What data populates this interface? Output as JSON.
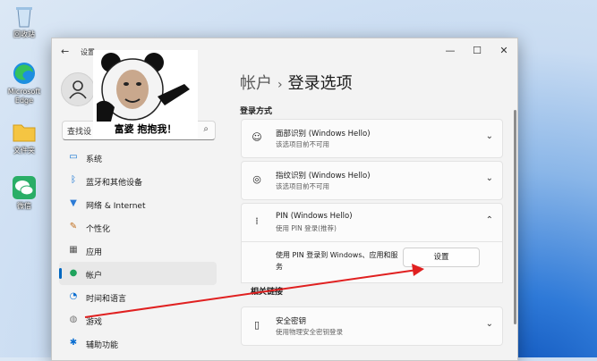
{
  "desktop": {
    "icons": [
      {
        "label": "回收站",
        "icon": "recycle-bin-icon"
      },
      {
        "label": "Microsoft Edge",
        "icon": "edge-icon"
      },
      {
        "label": "文件夹",
        "icon": "folder-icon"
      },
      {
        "label": "微信",
        "icon": "wechat-icon"
      }
    ]
  },
  "window": {
    "title": "设置",
    "controls": {
      "minimize": "—",
      "maximize": "☐",
      "close": "✕"
    }
  },
  "sidebar": {
    "search_value": "查找设",
    "items": [
      {
        "label": "系统",
        "icon": "monitor-icon",
        "color": "#0a6ed1"
      },
      {
        "label": "蓝牙和其他设备",
        "icon": "bluetooth-icon",
        "color": "#0a6ed1"
      },
      {
        "label": "网络 & Internet",
        "icon": "wifi-icon",
        "color": "#2b7bd6"
      },
      {
        "label": "个性化",
        "icon": "brush-icon",
        "color": "#c06c1a"
      },
      {
        "label": "应用",
        "icon": "apps-icon",
        "color": "#555555"
      },
      {
        "label": "帐户",
        "icon": "person-icon",
        "color": "#1fa35d",
        "active": true
      },
      {
        "label": "时间和语言",
        "icon": "globe-clock-icon",
        "color": "#0a6ed1"
      },
      {
        "label": "游戏",
        "icon": "gamepad-icon",
        "color": "#777777"
      },
      {
        "label": "辅助功能",
        "icon": "accessibility-icon",
        "color": "#0a6ed1"
      }
    ]
  },
  "main": {
    "breadcrumb_parent": "帐户",
    "breadcrumb_separator": "›",
    "breadcrumb_current": "登录选项",
    "section_title": "登录方式",
    "cards": [
      {
        "title": "面部识别 (Windows Hello)",
        "subtitle": "该选项目前不可用",
        "icon": "face-icon",
        "chevron": "⌄"
      },
      {
        "title": "指纹识别 (Windows Hello)",
        "subtitle": "该选项目前不可用",
        "icon": "fingerprint-icon",
        "chevron": "⌄"
      },
      {
        "title": "PIN (Windows Hello)",
        "subtitle": "使用 PIN 登录(推荐)",
        "icon": "pin-keypad-icon",
        "chevron": "⌃"
      }
    ],
    "pin_expanded_text": "使用 PIN 登录到 Windows、应用和服务",
    "setup_button": "设置",
    "related_label": "相关链接",
    "security_key": {
      "title": "安全密钥",
      "subtitle": "使用物理安全密钥登录",
      "icon": "usb-key-icon",
      "chevron": "⌄"
    }
  },
  "sticker": {
    "caption": "富婆 抱抱我！"
  },
  "annotation": {
    "arrow_color": "#e02020"
  }
}
